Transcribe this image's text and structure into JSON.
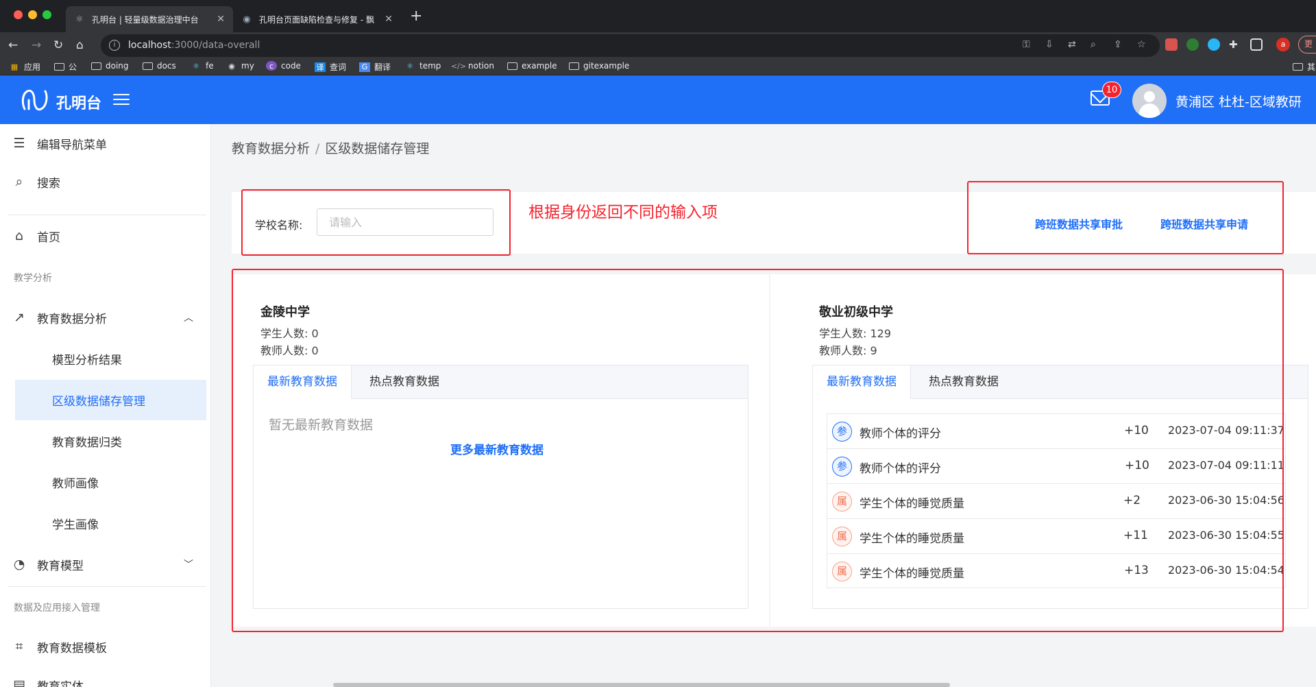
{
  "browser": {
    "tabs": [
      {
        "title": "孔明台 | 轻量级数据治理中台"
      },
      {
        "title": "孔明台页面缺陷检查与修复 - 飘"
      }
    ],
    "url_host": "localhost",
    "url_path": ":3000/data-overall",
    "profile_initial": "a",
    "update_label": "更",
    "bookmarks": [
      {
        "label": "应用",
        "icon": "apps-grid-icon"
      },
      {
        "label": "公",
        "icon": "folder-icon"
      },
      {
        "label": "doing",
        "icon": "folder-icon"
      },
      {
        "label": "docs",
        "icon": "folder-icon"
      },
      {
        "label": "fe",
        "icon": "react-icon"
      },
      {
        "label": "my",
        "icon": "eye-icon"
      },
      {
        "label": "code",
        "icon": "code-badge-icon"
      },
      {
        "label": "查词",
        "icon": "dictionary-icon"
      },
      {
        "label": "翻译",
        "icon": "translate-icon"
      },
      {
        "label": "temp",
        "icon": "react-icon"
      },
      {
        "label": "notion",
        "icon": "code-icon"
      },
      {
        "label": "example",
        "icon": "folder-icon"
      },
      {
        "label": "gitexample",
        "icon": "folder-icon"
      },
      {
        "label": "其",
        "icon": "folder-icon"
      }
    ]
  },
  "header": {
    "brand": "孔明台",
    "notification_count": "10",
    "user_text": "黄浦区  杜杜-区域教研"
  },
  "sidebar": {
    "edit_menu": "编辑导航菜单",
    "search": "搜索",
    "home": "首页",
    "group_teaching": "教学分析",
    "edu_analysis": "教育数据分析",
    "sub_items": [
      "模型分析结果",
      "区级数据储存管理",
      "教育数据归类",
      "教师画像",
      "学生画像"
    ],
    "edu_model": "教育模型",
    "group_data": "数据及应用接入管理",
    "data_template": "教育数据模板",
    "edu_entity": "教育实体"
  },
  "breadcrumb": {
    "parent": "教育数据分析",
    "separator": "/",
    "current": "区级数据储存管理"
  },
  "filter": {
    "school_label": "学校名称:",
    "school_placeholder": "请输入",
    "annotation": "根据身份返回不同的输入项",
    "link_approve": "跨班数据共享审批",
    "link_apply": "跨班数据共享申请"
  },
  "schools": [
    {
      "name": "金陵中学",
      "students": "学生人数:  0",
      "teachers": "教师人数:  0",
      "tab_latest": "最新教育数据",
      "tab_hot": "热点教育数据",
      "empty_text": "暂无最新教育数据",
      "more_link": "更多最新教育数据"
    },
    {
      "name": "敬业初级中学",
      "students": "学生人数:  129",
      "teachers": "教师人数:  9",
      "tab_latest": "最新教育数据",
      "tab_hot": "热点教育数据",
      "rows": [
        {
          "tag": "参",
          "tag_color": "#1f6ff7",
          "title": "教师个体的评分",
          "delta": "+10",
          "time": "2023-07-04 09:11:37"
        },
        {
          "tag": "参",
          "tag_color": "#1f6ff7",
          "title": "教师个体的评分",
          "delta": "+10",
          "time": "2023-07-04 09:11:11"
        },
        {
          "tag": "属",
          "tag_color": "#f06d4f",
          "title": "学生个体的睡觉质量",
          "delta": "+2",
          "time": "2023-06-30 15:04:56"
        },
        {
          "tag": "属",
          "tag_color": "#f06d4f",
          "title": "学生个体的睡觉质量",
          "delta": "+11",
          "time": "2023-06-30 15:04:55"
        },
        {
          "tag": "属",
          "tag_color": "#f06d4f",
          "title": "学生个体的睡觉质量",
          "delta": "+13",
          "time": "2023-06-30 15:04:54"
        }
      ]
    }
  ],
  "colors": {
    "accent": "#1f6ff7",
    "annotation_red": "#f5222d",
    "tag_orange": "#f06d4f"
  }
}
